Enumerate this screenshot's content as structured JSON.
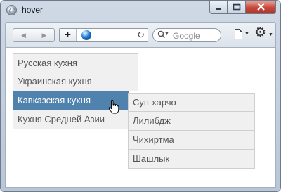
{
  "window": {
    "title": "hover"
  },
  "toolbar": {
    "back_glyph": "◀",
    "forward_glyph": "▶",
    "add_glyph": "+",
    "reload_glyph": "↻",
    "search_placeholder": "Google"
  },
  "menu": {
    "items": [
      {
        "label": "Русская кухня"
      },
      {
        "label": "Украинская кухня"
      },
      {
        "label": "Кавказская кухня"
      },
      {
        "label": "Кухня Средней Азии"
      }
    ],
    "active_index": 2,
    "active_color": "#4f82ad"
  },
  "submenu": {
    "items": [
      {
        "label": "Суп-харчо"
      },
      {
        "label": "Лилибдж"
      },
      {
        "label": "Чихиртма"
      },
      {
        "label": "Шашлык"
      }
    ]
  },
  "icons": [
    "app-globe-icon",
    "back-icon",
    "forward-icon",
    "add-icon",
    "globe-icon",
    "reload-icon",
    "search-icon",
    "page-icon",
    "gear-icon",
    "hand-cursor-icon"
  ]
}
